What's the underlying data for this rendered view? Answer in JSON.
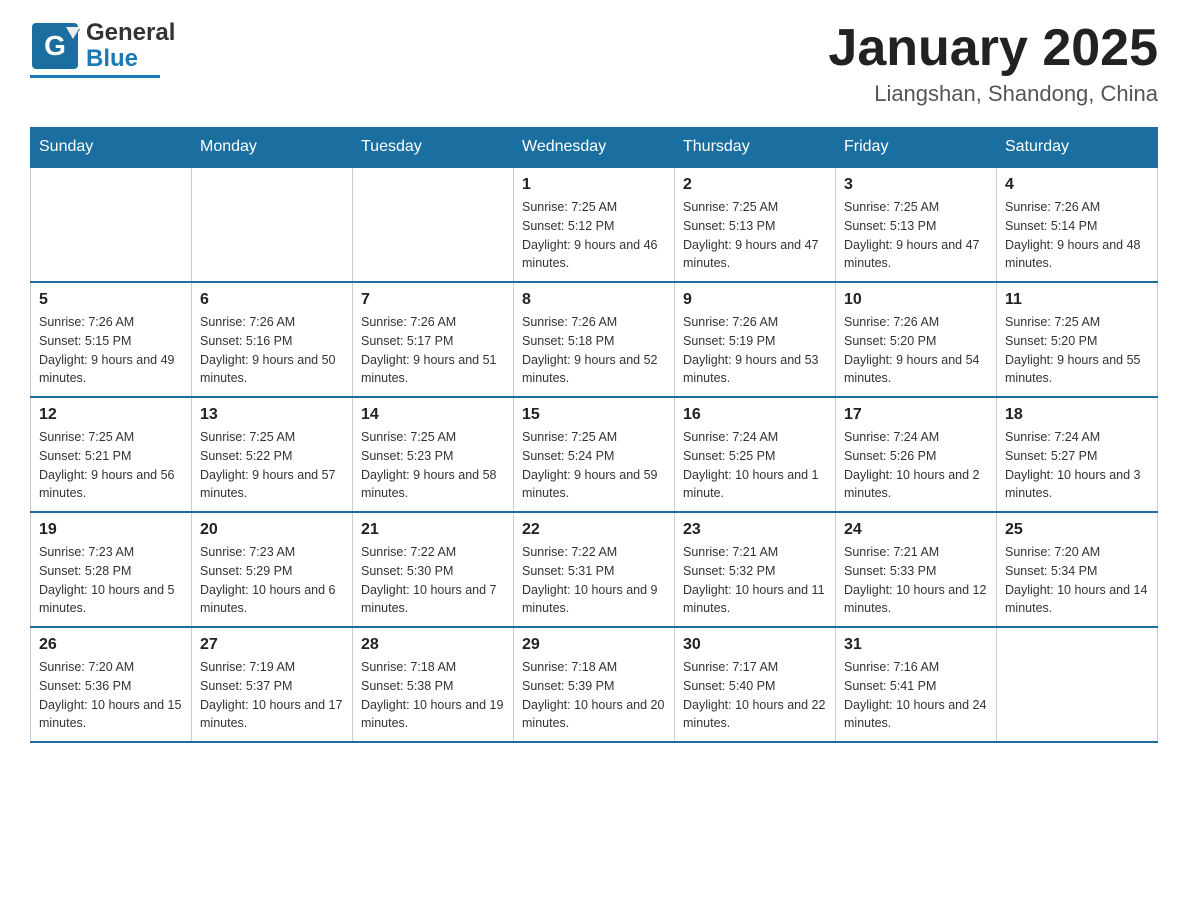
{
  "header": {
    "logo_general": "General",
    "logo_blue": "Blue",
    "title": "January 2025",
    "subtitle": "Liangshan, Shandong, China"
  },
  "calendar": {
    "days_of_week": [
      "Sunday",
      "Monday",
      "Tuesday",
      "Wednesday",
      "Thursday",
      "Friday",
      "Saturday"
    ],
    "weeks": [
      [
        {
          "day": "",
          "info": ""
        },
        {
          "day": "",
          "info": ""
        },
        {
          "day": "",
          "info": ""
        },
        {
          "day": "1",
          "info": "Sunrise: 7:25 AM\nSunset: 5:12 PM\nDaylight: 9 hours and 46 minutes."
        },
        {
          "day": "2",
          "info": "Sunrise: 7:25 AM\nSunset: 5:13 PM\nDaylight: 9 hours and 47 minutes."
        },
        {
          "day": "3",
          "info": "Sunrise: 7:25 AM\nSunset: 5:13 PM\nDaylight: 9 hours and 47 minutes."
        },
        {
          "day": "4",
          "info": "Sunrise: 7:26 AM\nSunset: 5:14 PM\nDaylight: 9 hours and 48 minutes."
        }
      ],
      [
        {
          "day": "5",
          "info": "Sunrise: 7:26 AM\nSunset: 5:15 PM\nDaylight: 9 hours and 49 minutes."
        },
        {
          "day": "6",
          "info": "Sunrise: 7:26 AM\nSunset: 5:16 PM\nDaylight: 9 hours and 50 minutes."
        },
        {
          "day": "7",
          "info": "Sunrise: 7:26 AM\nSunset: 5:17 PM\nDaylight: 9 hours and 51 minutes."
        },
        {
          "day": "8",
          "info": "Sunrise: 7:26 AM\nSunset: 5:18 PM\nDaylight: 9 hours and 52 minutes."
        },
        {
          "day": "9",
          "info": "Sunrise: 7:26 AM\nSunset: 5:19 PM\nDaylight: 9 hours and 53 minutes."
        },
        {
          "day": "10",
          "info": "Sunrise: 7:26 AM\nSunset: 5:20 PM\nDaylight: 9 hours and 54 minutes."
        },
        {
          "day": "11",
          "info": "Sunrise: 7:25 AM\nSunset: 5:20 PM\nDaylight: 9 hours and 55 minutes."
        }
      ],
      [
        {
          "day": "12",
          "info": "Sunrise: 7:25 AM\nSunset: 5:21 PM\nDaylight: 9 hours and 56 minutes."
        },
        {
          "day": "13",
          "info": "Sunrise: 7:25 AM\nSunset: 5:22 PM\nDaylight: 9 hours and 57 minutes."
        },
        {
          "day": "14",
          "info": "Sunrise: 7:25 AM\nSunset: 5:23 PM\nDaylight: 9 hours and 58 minutes."
        },
        {
          "day": "15",
          "info": "Sunrise: 7:25 AM\nSunset: 5:24 PM\nDaylight: 9 hours and 59 minutes."
        },
        {
          "day": "16",
          "info": "Sunrise: 7:24 AM\nSunset: 5:25 PM\nDaylight: 10 hours and 1 minute."
        },
        {
          "day": "17",
          "info": "Sunrise: 7:24 AM\nSunset: 5:26 PM\nDaylight: 10 hours and 2 minutes."
        },
        {
          "day": "18",
          "info": "Sunrise: 7:24 AM\nSunset: 5:27 PM\nDaylight: 10 hours and 3 minutes."
        }
      ],
      [
        {
          "day": "19",
          "info": "Sunrise: 7:23 AM\nSunset: 5:28 PM\nDaylight: 10 hours and 5 minutes."
        },
        {
          "day": "20",
          "info": "Sunrise: 7:23 AM\nSunset: 5:29 PM\nDaylight: 10 hours and 6 minutes."
        },
        {
          "day": "21",
          "info": "Sunrise: 7:22 AM\nSunset: 5:30 PM\nDaylight: 10 hours and 7 minutes."
        },
        {
          "day": "22",
          "info": "Sunrise: 7:22 AM\nSunset: 5:31 PM\nDaylight: 10 hours and 9 minutes."
        },
        {
          "day": "23",
          "info": "Sunrise: 7:21 AM\nSunset: 5:32 PM\nDaylight: 10 hours and 11 minutes."
        },
        {
          "day": "24",
          "info": "Sunrise: 7:21 AM\nSunset: 5:33 PM\nDaylight: 10 hours and 12 minutes."
        },
        {
          "day": "25",
          "info": "Sunrise: 7:20 AM\nSunset: 5:34 PM\nDaylight: 10 hours and 14 minutes."
        }
      ],
      [
        {
          "day": "26",
          "info": "Sunrise: 7:20 AM\nSunset: 5:36 PM\nDaylight: 10 hours and 15 minutes."
        },
        {
          "day": "27",
          "info": "Sunrise: 7:19 AM\nSunset: 5:37 PM\nDaylight: 10 hours and 17 minutes."
        },
        {
          "day": "28",
          "info": "Sunrise: 7:18 AM\nSunset: 5:38 PM\nDaylight: 10 hours and 19 minutes."
        },
        {
          "day": "29",
          "info": "Sunrise: 7:18 AM\nSunset: 5:39 PM\nDaylight: 10 hours and 20 minutes."
        },
        {
          "day": "30",
          "info": "Sunrise: 7:17 AM\nSunset: 5:40 PM\nDaylight: 10 hours and 22 minutes."
        },
        {
          "day": "31",
          "info": "Sunrise: 7:16 AM\nSunset: 5:41 PM\nDaylight: 10 hours and 24 minutes."
        },
        {
          "day": "",
          "info": ""
        }
      ]
    ]
  }
}
